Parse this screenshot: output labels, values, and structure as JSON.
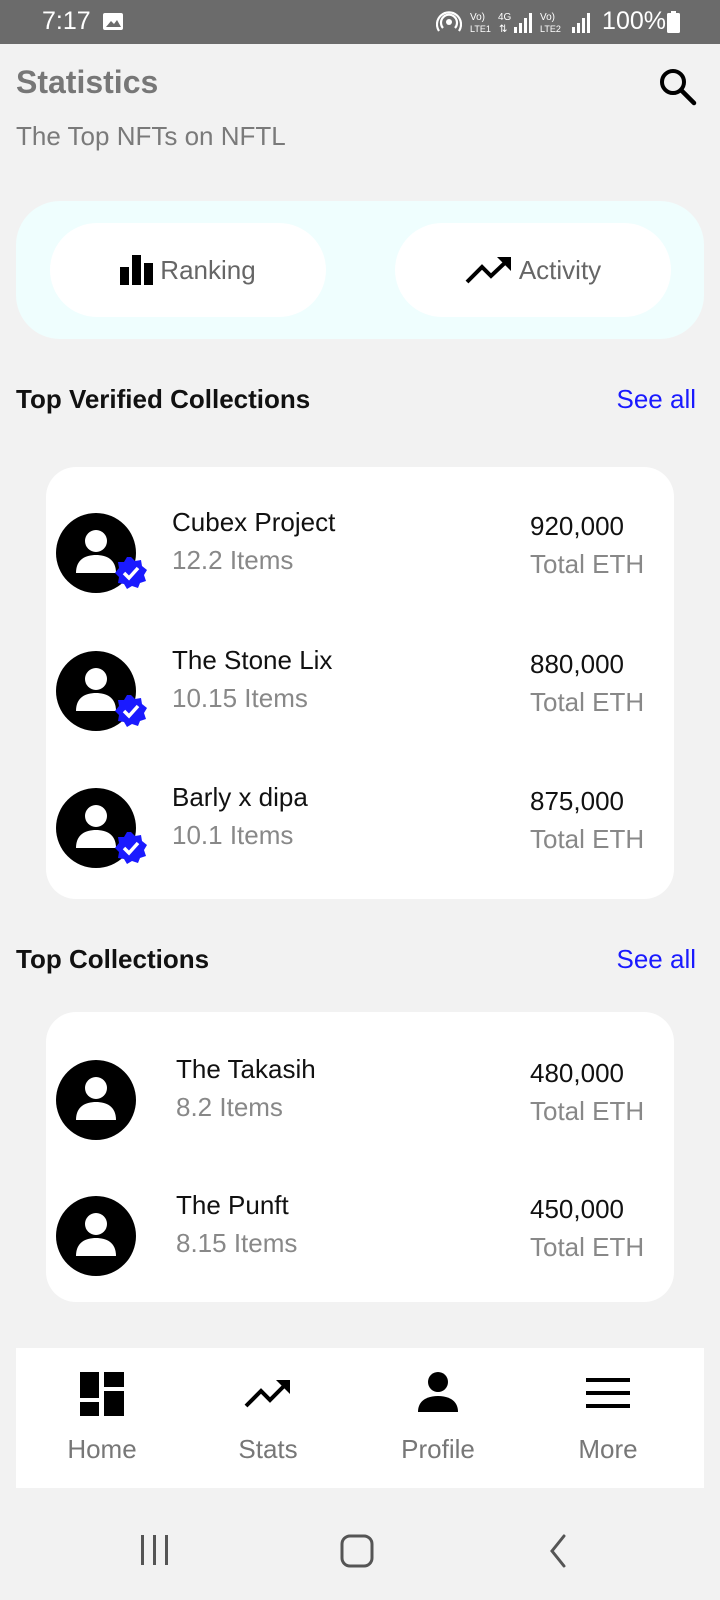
{
  "status_bar": {
    "time": "7:17",
    "battery": "100%",
    "network_1": "Vo) LTE1",
    "network_2": "4G",
    "network_3": "Vo) LTE2"
  },
  "header": {
    "title": "Statistics",
    "subtitle": "The Top NFTs on NFTL",
    "search_icon": "search-icon"
  },
  "segment": {
    "ranking_label": "Ranking",
    "activity_label": "Activity"
  },
  "verified_section": {
    "title": "Top Verified Collections",
    "see_all": "See all",
    "items": [
      {
        "name": "Cubex Project",
        "items": "12.2 Items",
        "value": "920,000",
        "unit": "Total ETH"
      },
      {
        "name": "The Stone Lix",
        "items": "10.15 Items",
        "value": "880,000",
        "unit": "Total ETH"
      },
      {
        "name": "Barly x dipa",
        "items": "10.1 Items",
        "value": "875,000",
        "unit": "Total ETH"
      }
    ]
  },
  "top_section": {
    "title": "Top Collections",
    "see_all": "See all",
    "items": [
      {
        "name": "The Takasih",
        "items": "8.2 Items",
        "value": "480,000",
        "unit": "Total ETH"
      },
      {
        "name": "The Punft",
        "items": "8.15 Items",
        "value": "450,000",
        "unit": "Total ETH"
      }
    ]
  },
  "bottom_nav": {
    "home": "Home",
    "stats": "Stats",
    "profile": "Profile",
    "more": "More"
  },
  "colors": {
    "accent_link": "#1a1aff",
    "badge": "#1a1aff",
    "segment_bg": "#effefe",
    "status_bar": "#6b6b6b"
  }
}
